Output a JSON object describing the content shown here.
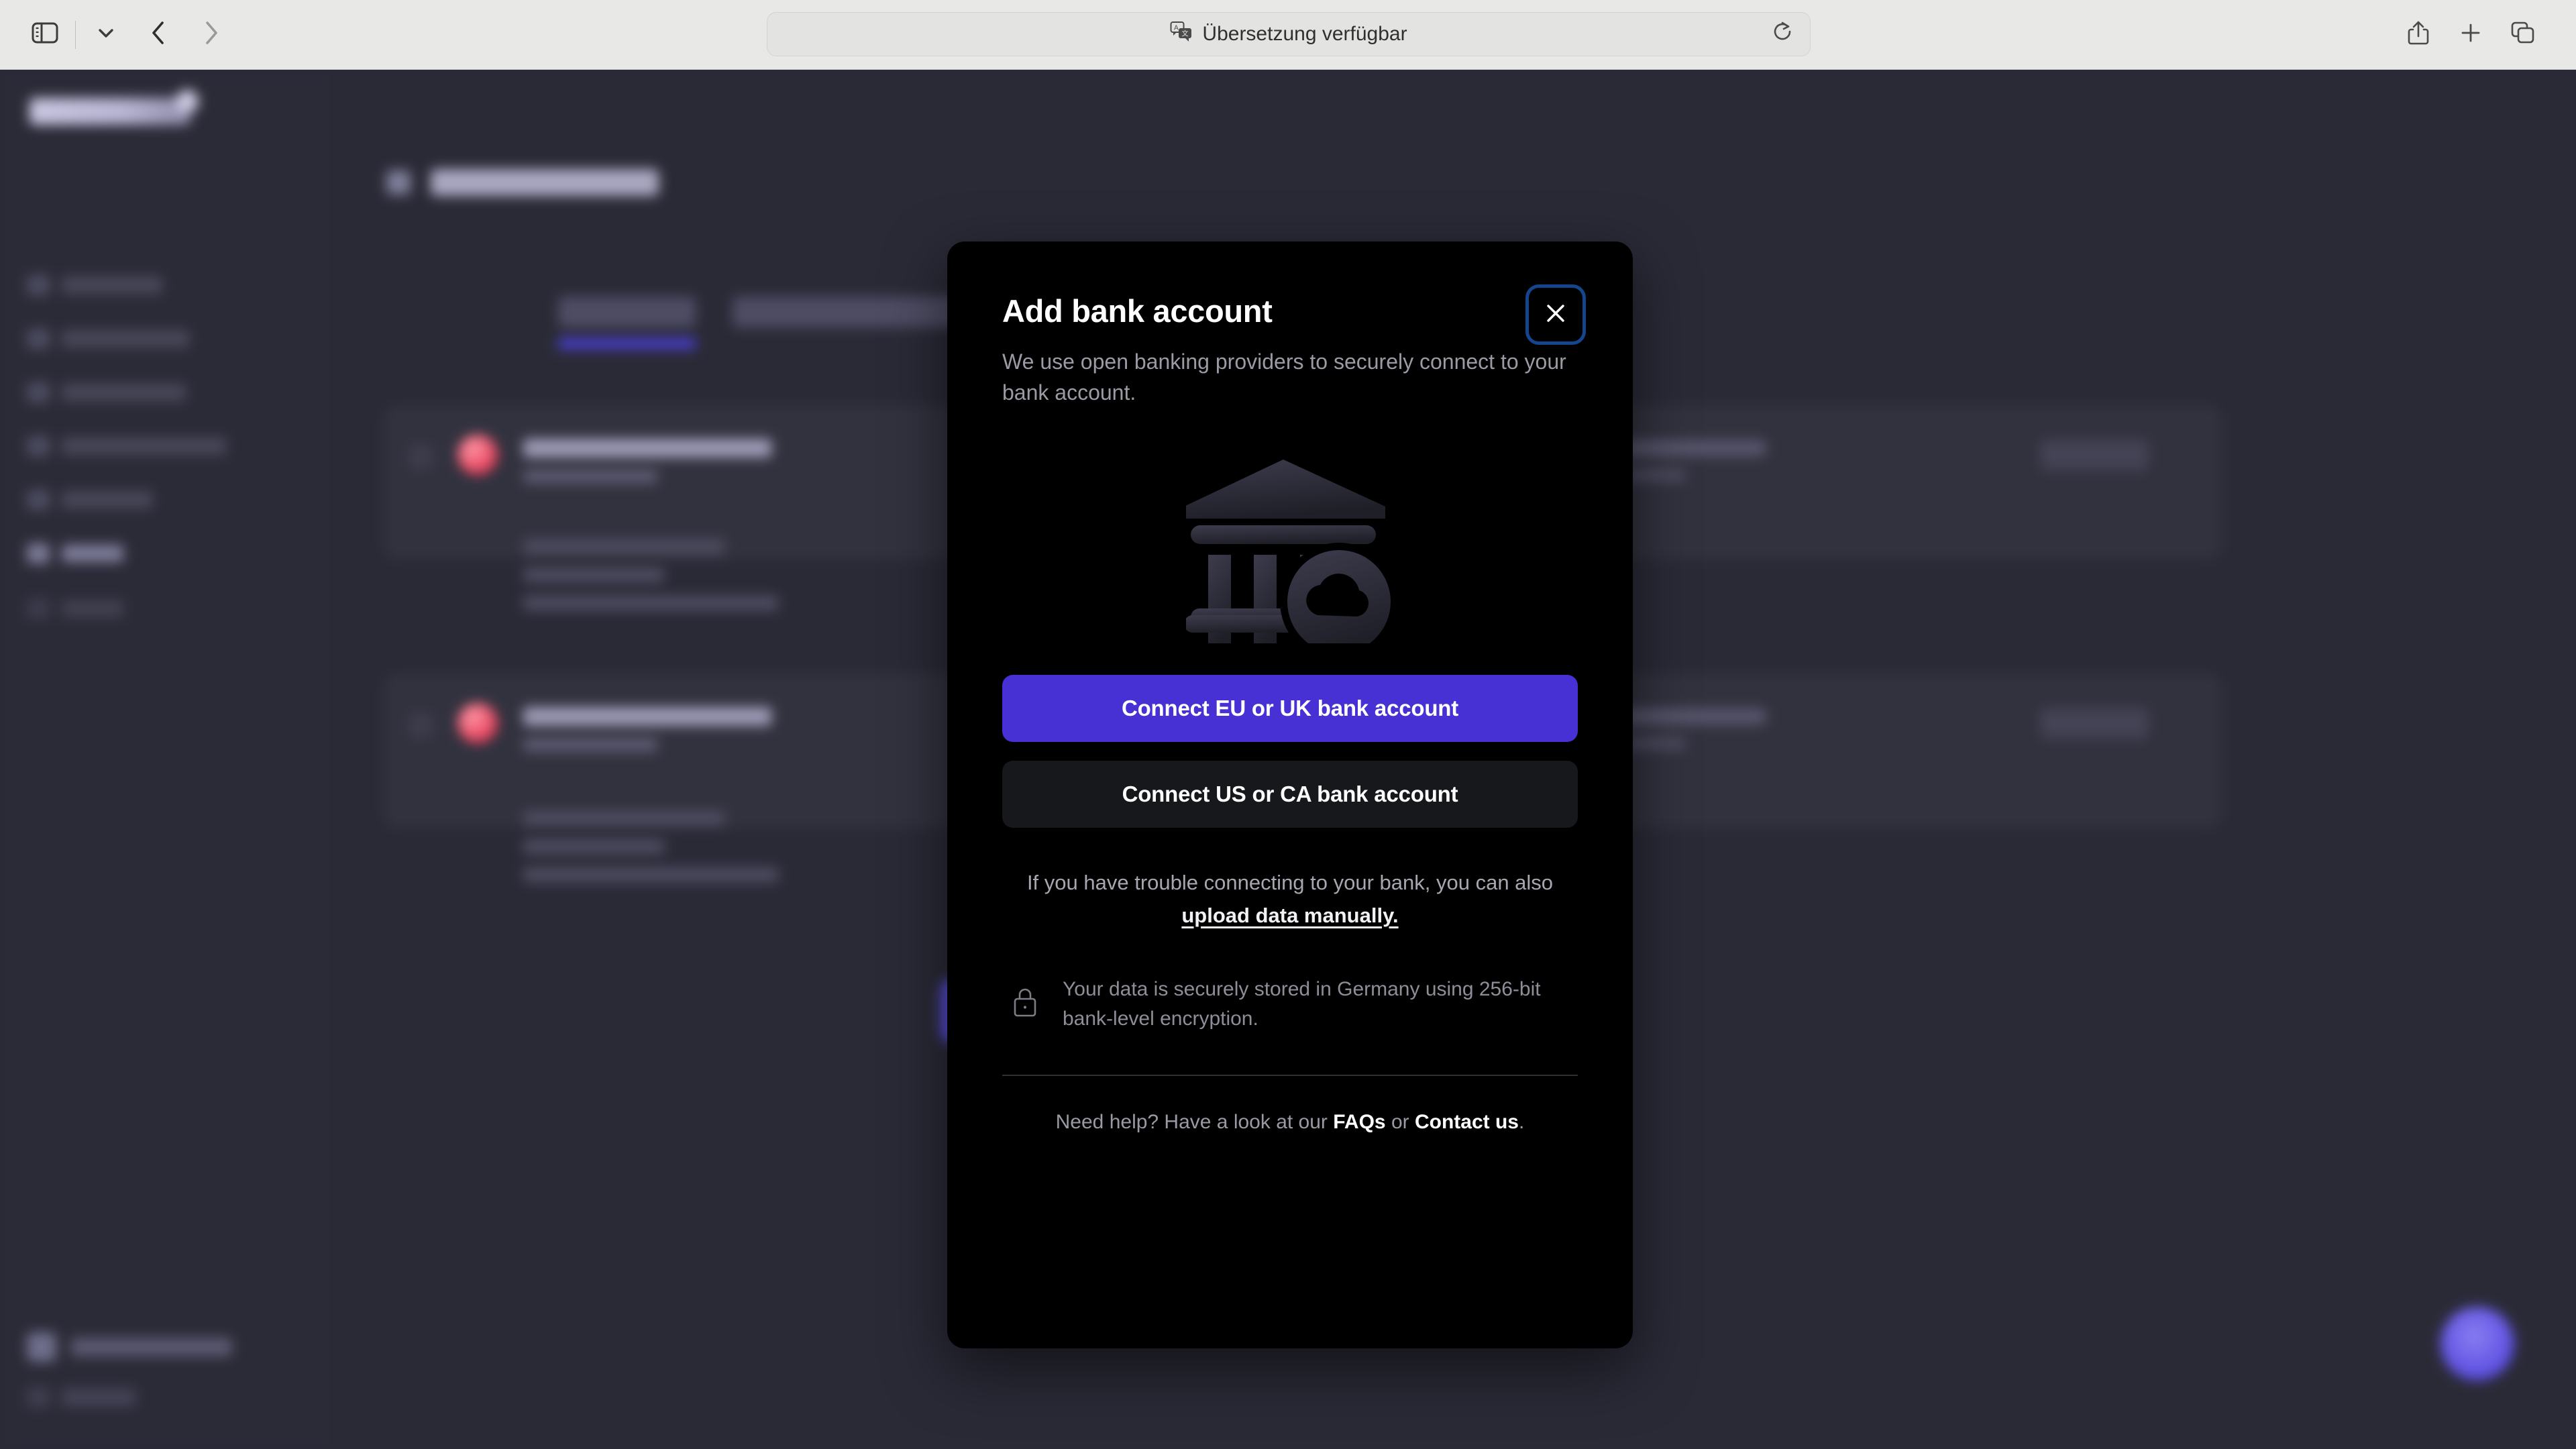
{
  "browser": {
    "sidebar_toggle_icon": "sidebar-icon",
    "sidebar_chevron_icon": "chevron-down-icon",
    "back_icon": "back-chevron-icon",
    "forward_icon": "forward-chevron-icon",
    "address_text": "Übersetzung verfügbar",
    "translate_icon": "translate-icon",
    "reload_icon": "reload-icon",
    "share_icon": "share-icon",
    "new_tab_icon": "plus-icon",
    "tab_overview_icon": "tabs-icon"
  },
  "modal": {
    "title": "Add bank account",
    "subtitle": "We use open banking providers to securely connect to your bank account.",
    "close_label": "Close",
    "close_icon": "close-icon",
    "illustration_icon": "bank-cloud-icon",
    "primary_button": "Connect EU or UK bank account",
    "secondary_button": "Connect US or CA bank account",
    "trouble_prefix": "If you have trouble connecting to your bank, you can also",
    "trouble_link": "upload data manually.",
    "lock_icon": "lock-icon",
    "security_note": "Your data is securely stored in Germany using 256-bit bank-level encryption.",
    "footer_prefix": "Need help? Have a look at our",
    "footer_faq_link": "FAQs",
    "footer_join": "or",
    "footer_contact_link": "Contact us",
    "footer_suffix": "."
  },
  "colors": {
    "modal_background": "#000000",
    "primary_button": "#4831d4",
    "secondary_button": "#17181c",
    "focus_ring": "#13468f",
    "app_background": "#2a2a37",
    "chrome_background": "#e8e8e6",
    "accent_purple": "#5a4fe0",
    "avatar_red": "#e8455f"
  }
}
